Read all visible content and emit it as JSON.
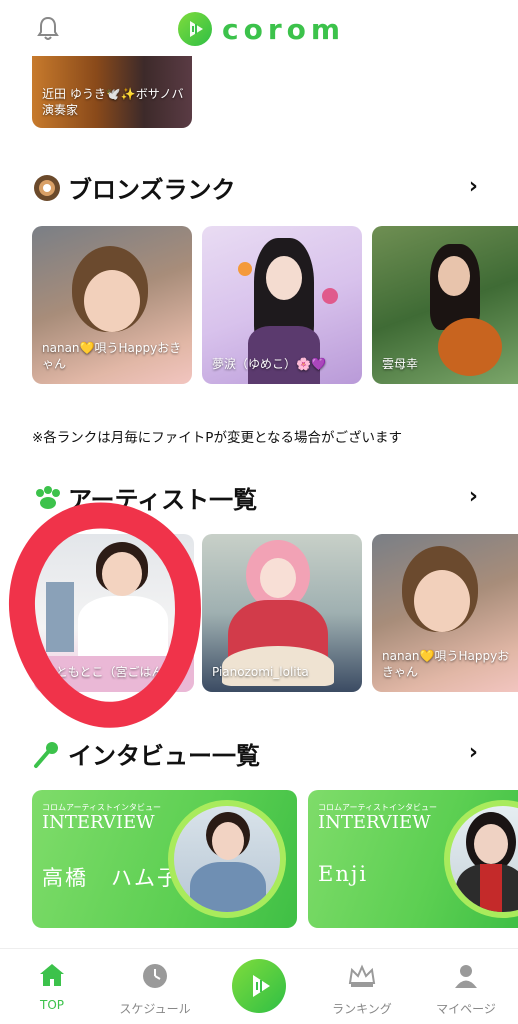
{
  "header": {
    "app_name": "corom"
  },
  "top_card": {
    "caption": "近田 ゆうき🕊️✨ボサノバ演奏家"
  },
  "bronze": {
    "title": "ブロンズランク",
    "cards": [
      {
        "caption": "nanan💛唄うHappyおきゃん"
      },
      {
        "caption": "夢涙（ゆめこ）🌸💜"
      },
      {
        "caption": "雲母幸"
      }
    ]
  },
  "note": "※各ランクは月毎にファイトPが変更となる場合がございます",
  "artists": {
    "title": "アーティスト一覧",
    "cards": [
      {
        "caption": "もともとこ（宮ごはん）"
      },
      {
        "caption": "Pianozomi_lolita"
      },
      {
        "caption": "nanan💛唄うHappyおきゃん"
      }
    ]
  },
  "interviews": {
    "title": "インタビュー一覧",
    "cards": [
      {
        "small": "コロムアーティストインタビュー",
        "heading": "INTERVIEW",
        "name": "高橋　ハム子"
      },
      {
        "small": "コロムアーティストインタビュー",
        "heading": "INTERVIEW",
        "name": "Enji"
      }
    ]
  },
  "nav": {
    "items": [
      {
        "label": "TOP",
        "icon": "home-icon",
        "active": true
      },
      {
        "label": "スケジュール",
        "icon": "clock-icon"
      },
      {
        "label": "",
        "icon": "play-logo-icon"
      },
      {
        "label": "ランキング",
        "icon": "crown-icon"
      },
      {
        "label": "マイページ",
        "icon": "user-icon"
      }
    ]
  },
  "colors": {
    "accent": "#3cc24b",
    "annotation": "#f0334a",
    "nav_inactive": "#888888"
  }
}
